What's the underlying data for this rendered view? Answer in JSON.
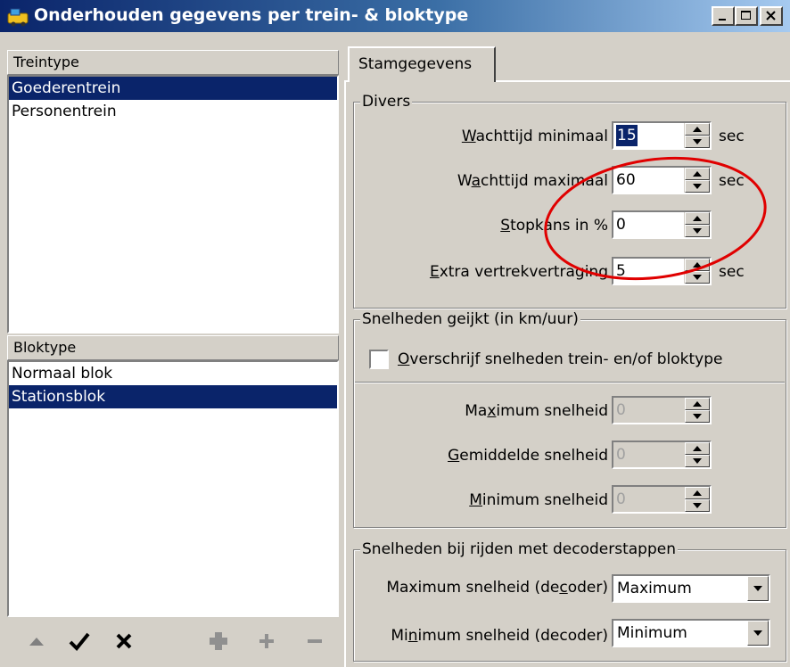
{
  "window": {
    "title": "Onderhouden gegevens per trein- & bloktype"
  },
  "treintype": {
    "header": "Treintype",
    "items": [
      {
        "label": "Goederentrein",
        "selected": true
      },
      {
        "label": "Personentrein",
        "selected": false
      }
    ]
  },
  "bloktype": {
    "header": "Bloktype",
    "items": [
      {
        "label": "Normaal blok",
        "selected": false
      },
      {
        "label": "Stationsblok",
        "selected": true
      }
    ]
  },
  "toolbar": {
    "icons": [
      "arrow-up-icon",
      "check-icon",
      "cross-icon",
      "puzzle-icon",
      "plus-icon",
      "minus-icon"
    ]
  },
  "tabs": [
    {
      "label": "Stamgegevens",
      "active": true
    }
  ],
  "divers": {
    "legend": "Divers",
    "wachttijd_min": {
      "label_pre": "",
      "label_u": "W",
      "label_post": "achttijd minimaal",
      "value": "15",
      "unit": "sec"
    },
    "wachttijd_max": {
      "label_pre": "W",
      "label_u": "a",
      "label_post": "chttijd maximaal",
      "value": "60",
      "unit": "sec"
    },
    "stopkans": {
      "label_pre": "",
      "label_u": "S",
      "label_post": "topkans in %",
      "value": "0"
    },
    "extra": {
      "label_pre": "",
      "label_u": "E",
      "label_post": "xtra vertrekvertraging",
      "value": "5",
      "unit": "sec"
    }
  },
  "snelheden_geijkt": {
    "legend": "Snelheden geijkt (in km/uur)",
    "overschrijf": {
      "label_pre": "",
      "label_u": "O",
      "label_post": "verschrijf snelheden trein- en/of bloktype",
      "checked": false
    },
    "maximum": {
      "label_pre": "Ma",
      "label_u": "x",
      "label_post": "imum snelheid",
      "value": "0"
    },
    "gemiddelde": {
      "label_pre": "",
      "label_u": "G",
      "label_post": "emiddelde snelheid",
      "value": "0"
    },
    "minimum": {
      "label_pre": "",
      "label_u": "M",
      "label_post": "inimum snelheid",
      "value": "0"
    }
  },
  "snelheden_decoder": {
    "legend": "Snelheden bij rijden met decoderstappen",
    "maximum": {
      "label_pre": "Maximum snelheid (de",
      "label_u": "c",
      "label_post": "oder)",
      "value": "Maximum"
    },
    "minimum": {
      "label_pre": "Mi",
      "label_u": "n",
      "label_post": "imum snelheid (decoder)",
      "value": "Minimum"
    }
  },
  "annotation": {
    "color": "#e00000"
  },
  "colors": {
    "selection": "#0a246a",
    "face": "#d4d0c8"
  }
}
